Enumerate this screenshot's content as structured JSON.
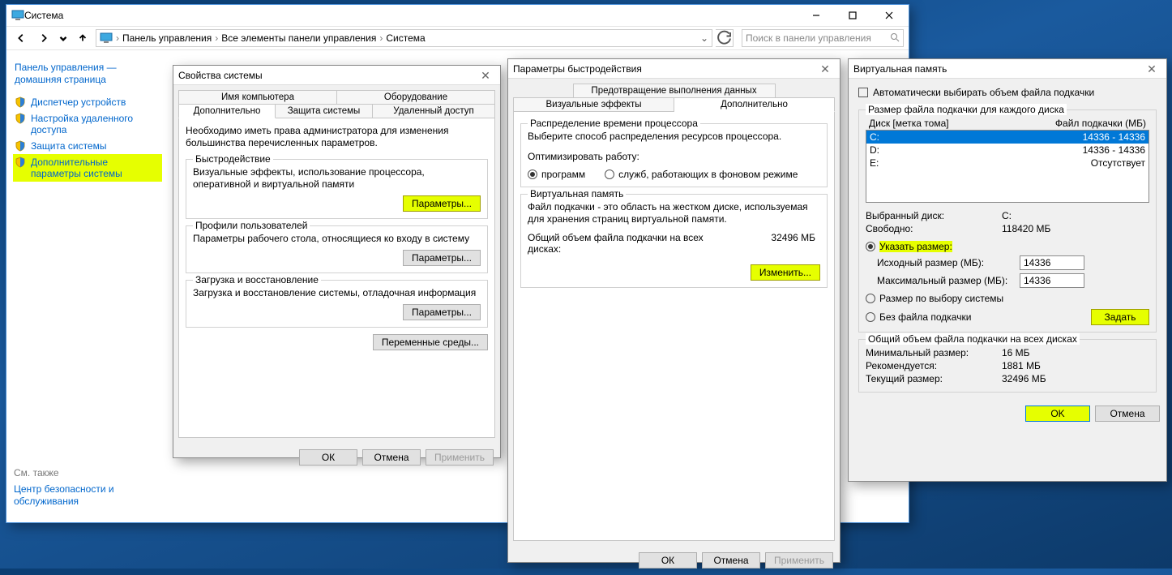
{
  "explorer": {
    "title": "Система",
    "breadcrumb": [
      "Панель управления",
      "Все элементы панели управления",
      "Система"
    ],
    "search_placeholder": "Поиск в панели управления",
    "sidebar": {
      "home": "Панель управления — домашняя страница",
      "items": [
        "Диспетчер устройств",
        "Настройка удаленного доступа",
        "Защита системы",
        "Дополнительные параметры системы"
      ],
      "see_also_hdr": "См. также",
      "see_also": "Центр безопасности и обслуживания"
    }
  },
  "sysprops": {
    "title": "Свойства системы",
    "tabs_row1": [
      "Имя компьютера",
      "Оборудование"
    ],
    "tabs_row2": [
      "Дополнительно",
      "Защита системы",
      "Удаленный доступ"
    ],
    "intro": "Необходимо иметь права администратора для изменения большинства перечисленных параметров.",
    "perf_title": "Быстродействие",
    "perf_text": "Визуальные эффекты, использование процессора, оперативной и виртуальной памяти",
    "perf_btn": "Параметры...",
    "profiles_title": "Профили пользователей",
    "profiles_text": "Параметры рабочего стола, относящиеся ко входу в систему",
    "profiles_btn": "Параметры...",
    "startup_title": "Загрузка и восстановление",
    "startup_text": "Загрузка и восстановление системы, отладочная информация",
    "startup_btn": "Параметры...",
    "envvars_btn": "Переменные среды...",
    "ok": "ОК",
    "cancel": "Отмена",
    "apply": "Применить"
  },
  "perfopts": {
    "title": "Параметры быстродействия",
    "tabs_row1": [
      "Предотвращение выполнения данных"
    ],
    "tabs_row2": [
      "Визуальные эффекты",
      "Дополнительно"
    ],
    "sched_title": "Распределение времени процессора",
    "sched_text": "Выберите способ распределения ресурсов процессора.",
    "optimize_label": "Оптимизировать работу:",
    "opt_programs": "программ",
    "opt_services": "служб, работающих в фоновом режиме",
    "vmem_title": "Виртуальная память",
    "vmem_text": "Файл подкачки - это область на жестком диске, используемая для хранения страниц виртуальной памяти.",
    "vmem_total_label": "Общий объем файла подкачки на всех дисках:",
    "vmem_total_value": "32496 МБ",
    "change_btn": "Изменить...",
    "ok": "ОК",
    "cancel": "Отмена",
    "apply": "Применить"
  },
  "vmem": {
    "title": "Виртуальная память",
    "auto": "Автоматически выбирать объем файла подкачки",
    "perdrive_label": "Размер файла подкачки для каждого диска",
    "col_drive": "Диск [метка тома]",
    "col_page": "Файл подкачки (МБ)",
    "drives": [
      {
        "name": "C:",
        "value": "14336 - 14336",
        "selected": true
      },
      {
        "name": "D:",
        "value": "14336 - 14336",
        "selected": false
      },
      {
        "name": "E:",
        "value": "Отсутствует",
        "selected": false
      }
    ],
    "selected_label": "Выбранный диск:",
    "selected": "C:",
    "free_label": "Свободно:",
    "free": "118420 МБ",
    "radio_custom": "Указать размер:",
    "initial_label": "Исходный размер (МБ):",
    "initial": "14336",
    "max_label": "Максимальный размер (МБ):",
    "max": "14336",
    "radio_system": "Размер по выбору системы",
    "radio_none": "Без файла подкачки",
    "set_btn": "Задать",
    "total_title": "Общий объем файла подкачки на всех дисках",
    "min_label": "Минимальный размер:",
    "min_val": "16 МБ",
    "rec_label": "Рекомендуется:",
    "rec_val": "1881 МБ",
    "cur_label": "Текущий размер:",
    "cur_val": "32496 МБ",
    "ok": "OK",
    "cancel": "Отмена"
  }
}
